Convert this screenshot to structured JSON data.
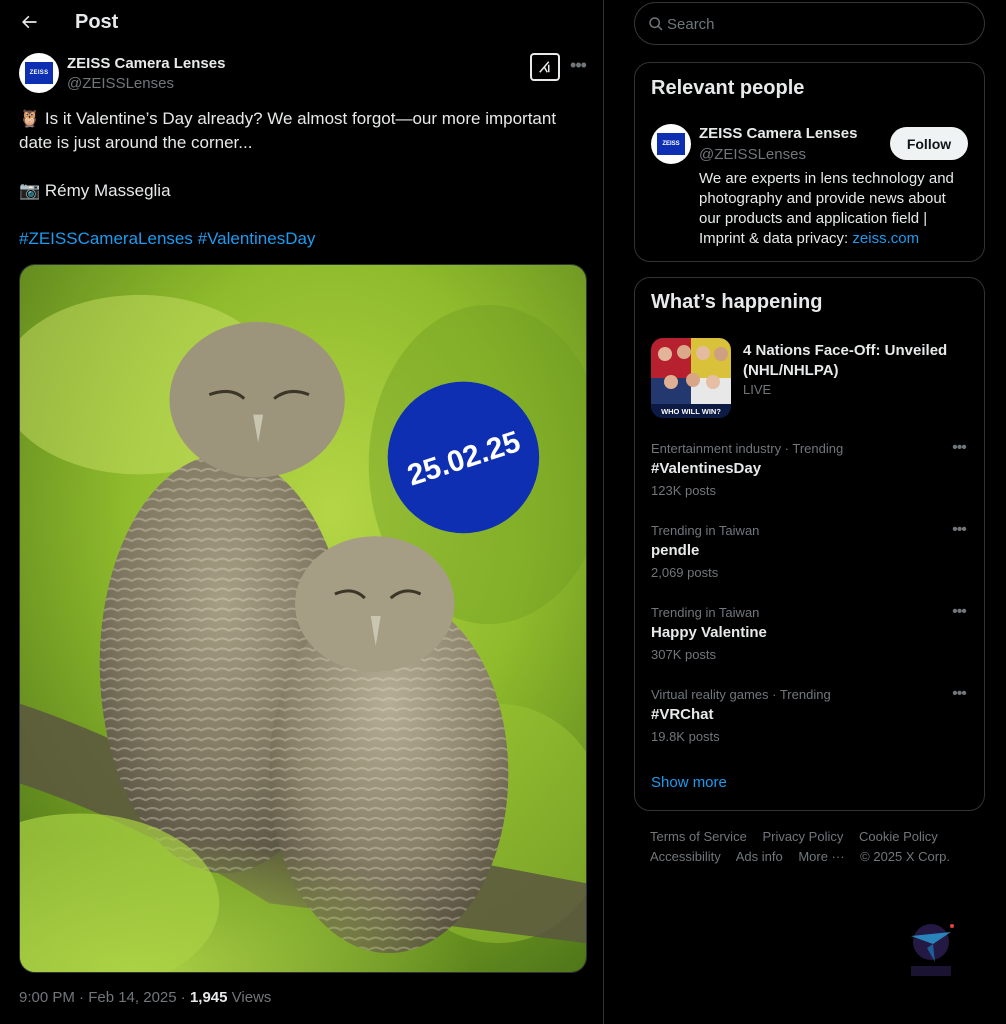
{
  "header": {
    "back_label": "Back",
    "title": "Post"
  },
  "post": {
    "author": {
      "name": "ZEISS Camera Lenses",
      "handle": "@ZEISSLenses",
      "avatar_text": "ZEISS"
    },
    "lines": [
      "🦉 Is it Valentine’s Day already? We almost forgot—our more important date is just around the corner...",
      "📷 Rémy Masseglia"
    ],
    "hashtags": [
      "#ZEISSCameraLenses",
      "#ValentinesDay"
    ],
    "image_badge_text": "25.02.25",
    "time": "9:00 PM · Feb 14, 2025",
    "separator": "·",
    "views_count": "1,945",
    "views_label": "Views",
    "more_icon": "more-horizontal-icon",
    "grok_icon": "grok-icon"
  },
  "search": {
    "placeholder": "Search"
  },
  "relevant_people": {
    "title": "Relevant people",
    "person": {
      "name": "ZEISS Camera Lenses",
      "handle": "@ZEISSLenses",
      "avatar_text": "ZEISS",
      "bio": "We are experts in lens technology and photography and provide news about our products and application field | Imprint & data privacy:",
      "bio_link": "zeiss.com",
      "follow_label": "Follow"
    }
  },
  "whats_happening": {
    "title": "What’s happening",
    "event": {
      "title": "4 Nations Face-Off: Unveiled (NHL/NHLPA)",
      "status": "LIVE",
      "image_caption": "WHO WILL WIN?"
    },
    "trends": [
      {
        "context": "Entertainment industry · Trending",
        "name": "#ValentinesDay",
        "count": "123K posts"
      },
      {
        "context": "Trending in Taiwan",
        "name": "pendle",
        "count": "2,069 posts"
      },
      {
        "context": "Trending in Taiwan",
        "name": "Happy Valentine",
        "count": "307K posts"
      },
      {
        "context": "Virtual reality games · Trending",
        "name": "#VRChat",
        "count": "19.8K posts"
      }
    ],
    "show_more": "Show more"
  },
  "footer": {
    "links": [
      "Terms of Service",
      "Privacy Policy",
      "Cookie Policy",
      "Accessibility",
      "Ads info",
      "More ···"
    ],
    "copyright": "© 2025 X Corp."
  },
  "colors": {
    "background": "#000000",
    "accent": "#1d9bf0",
    "zeiss_blue": "#0f2fb3",
    "muted_text": "#71767b"
  }
}
